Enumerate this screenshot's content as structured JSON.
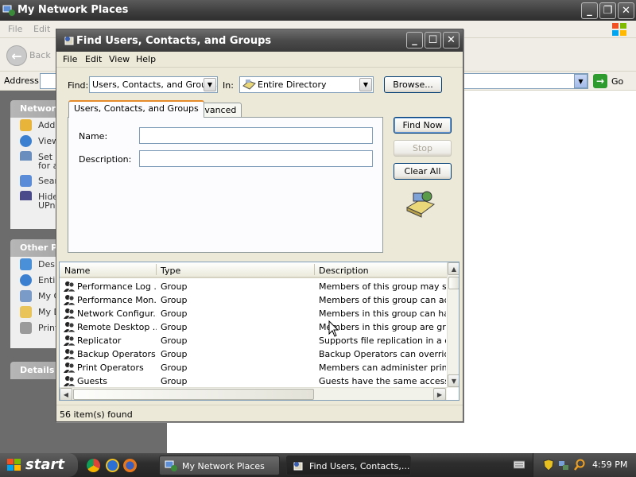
{
  "background_window": {
    "title": "My Network Places",
    "menu": [
      "File",
      "Edit"
    ],
    "back_label": "Back",
    "address_label": "Address",
    "go_label": "Go",
    "panels": [
      {
        "title": "Network",
        "items": [
          "Add",
          "View",
          "Set",
          "for a",
          "Sear",
          "Hide",
          "UPn"
        ]
      },
      {
        "title": "Other Pl",
        "items": [
          "Desk",
          "Entir",
          "My C",
          "My D",
          "Print"
        ]
      },
      {
        "title": "Details",
        "items": []
      }
    ]
  },
  "dialog": {
    "title": "Find Users, Contacts, and Groups",
    "menu": [
      "File",
      "Edit",
      "View",
      "Help"
    ],
    "find_label": "Find:",
    "find_value": "Users, Contacts, and Groups",
    "in_label": "In:",
    "in_value": "Entire Directory",
    "browse_label": "Browse...",
    "tabs": [
      "Users, Contacts, and Groups",
      "Advanced"
    ],
    "name_label": "Name:",
    "description_label": "Description:",
    "find_now_label": "Find Now",
    "stop_label": "Stop",
    "clear_all_label": "Clear All",
    "columns": [
      "Name",
      "Type",
      "Description"
    ],
    "rows": [
      {
        "name": "Performance Log ...",
        "type": "Group",
        "description": "Members of this group may sched"
      },
      {
        "name": "Performance Mon...",
        "type": "Group",
        "description": "Members of this group can access"
      },
      {
        "name": "Network Configur...",
        "type": "Group",
        "description": "Members in this group can have s"
      },
      {
        "name": "Remote Desktop ...",
        "type": "Group",
        "description": "Members in this group are granted"
      },
      {
        "name": "Replicator",
        "type": "Group",
        "description": "Supports file replication in a doma"
      },
      {
        "name": "Backup Operators",
        "type": "Group",
        "description": "Backup Operators can override se"
      },
      {
        "name": "Print Operators",
        "type": "Group",
        "description": "Members can administer printers i"
      },
      {
        "name": "Guests",
        "type": "Group",
        "description": "Guests have the same access as"
      }
    ],
    "status": "56 item(s) found"
  },
  "taskbar": {
    "start_label": "start",
    "buttons": [
      "My Network Places",
      "Find Users, Contacts,..."
    ],
    "clock": "4:59 PM"
  }
}
